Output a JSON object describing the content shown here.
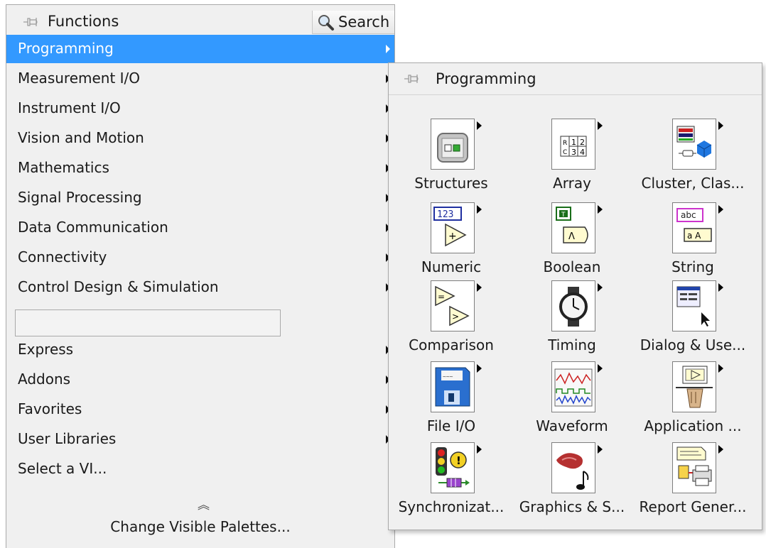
{
  "functions_palette": {
    "title": "Functions",
    "search_label": "Search",
    "categories": [
      {
        "label": "Programming",
        "selected": true,
        "has_submenu": true
      },
      {
        "label": "Measurement I/O",
        "has_submenu": true
      },
      {
        "label": "Instrument I/O",
        "has_submenu": true
      },
      {
        "label": "Vision and Motion",
        "has_submenu": true
      },
      {
        "label": "Mathematics",
        "has_submenu": true
      },
      {
        "label": "Signal Processing",
        "has_submenu": true
      },
      {
        "label": "Data Communication",
        "has_submenu": true
      },
      {
        "label": "Connectivity",
        "has_submenu": true
      },
      {
        "label": "Control Design & Simulation",
        "has_submenu": true
      },
      {
        "label": "Express",
        "has_submenu": true
      },
      {
        "label": "Addons",
        "has_submenu": true
      },
      {
        "label": "Favorites",
        "has_submenu": true
      },
      {
        "label": "User Libraries",
        "has_submenu": true
      },
      {
        "label": "Select a VI...",
        "has_submenu": false
      }
    ],
    "change_visible_label": "Change Visible Palettes..."
  },
  "programming_palette": {
    "title": "Programming",
    "items": [
      {
        "label": "Structures",
        "icon": "structures-icon"
      },
      {
        "label": "Array",
        "icon": "array-icon"
      },
      {
        "label": "Cluster, Clas...",
        "icon": "cluster-class-icon"
      },
      {
        "label": "Numeric",
        "icon": "numeric-icon"
      },
      {
        "label": "Boolean",
        "icon": "boolean-icon"
      },
      {
        "label": "String",
        "icon": "string-icon"
      },
      {
        "label": "Comparison",
        "icon": "comparison-icon"
      },
      {
        "label": "Timing",
        "icon": "timing-icon"
      },
      {
        "label": "Dialog & Use...",
        "icon": "dialog-user-interface-icon"
      },
      {
        "label": "File I/O",
        "icon": "file-io-icon"
      },
      {
        "label": "Waveform",
        "icon": "waveform-icon"
      },
      {
        "label": "Application ...",
        "icon": "application-control-icon"
      },
      {
        "label": "Synchronizat...",
        "icon": "synchronization-icon"
      },
      {
        "label": "Graphics & S...",
        "icon": "graphics-sound-icon"
      },
      {
        "label": "Report Gener...",
        "icon": "report-generation-icon"
      }
    ]
  },
  "colors": {
    "selection": "#3399ff",
    "panel_bg": "#f0f0f0",
    "border": "#a9a9a9"
  }
}
